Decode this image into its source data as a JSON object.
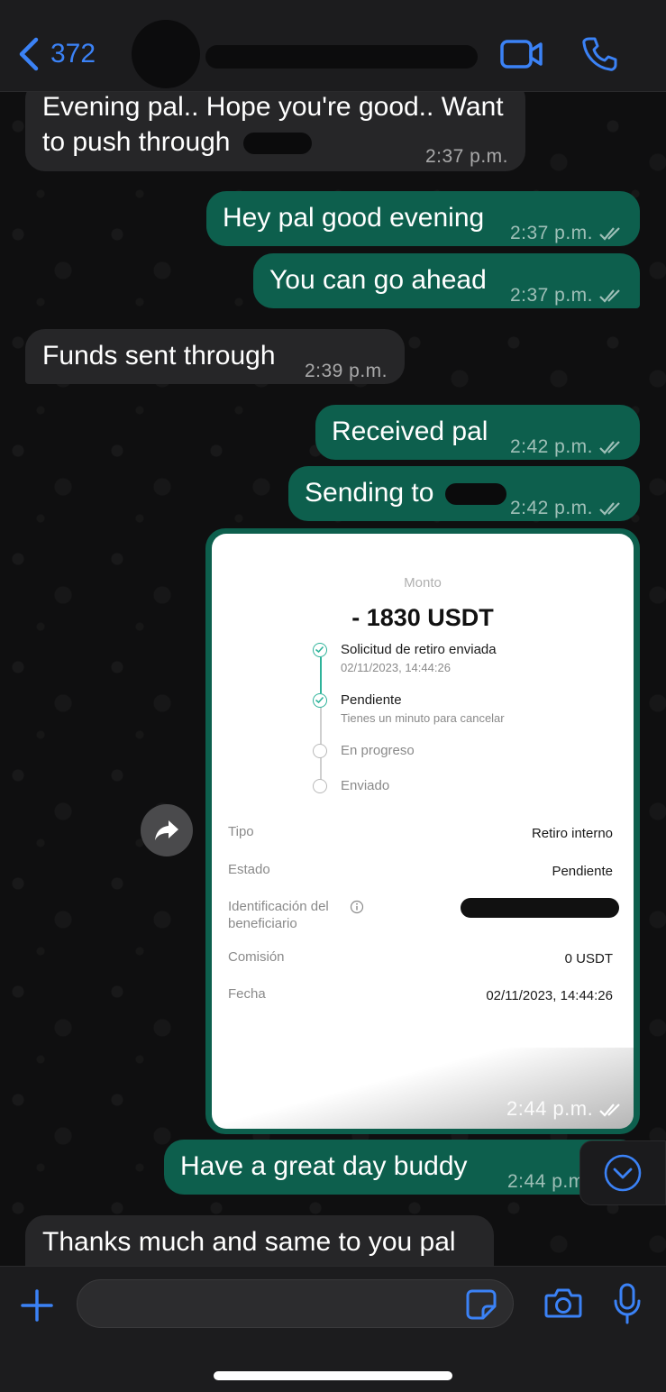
{
  "header": {
    "back_count": "372",
    "contact_name": "",
    "video_icon": "video-camera-icon",
    "call_icon": "phone-icon"
  },
  "messages": [
    {
      "direction": "incoming",
      "text_line1": "Evening pal.. Hope you're good.. Want",
      "text_line2": "to push through",
      "time": "2:37 p.m."
    },
    {
      "direction": "outgoing",
      "text": "Hey pal good evening",
      "time": "2:37 p.m.",
      "status": "read"
    },
    {
      "direction": "outgoing",
      "text": "You can go ahead",
      "time": "2:37 p.m.",
      "status": "read"
    },
    {
      "direction": "incoming",
      "text": "Funds sent through",
      "time": "2:39 p.m."
    },
    {
      "direction": "outgoing",
      "text": "Received pal",
      "time": "2:42 p.m.",
      "status": "read"
    },
    {
      "direction": "outgoing",
      "text": "Sending to",
      "time": "2:42 p.m.",
      "status": "read"
    },
    {
      "direction": "outgoing",
      "type": "image",
      "time": "2:44 p.m.",
      "status": "read"
    },
    {
      "direction": "outgoing",
      "text": "Have a great day buddy",
      "time": "2:44 p.m.",
      "status": "read"
    },
    {
      "direction": "incoming",
      "text": "Thanks much and same to you pal"
    }
  ],
  "receipt": {
    "amount_label": "Monto",
    "amount": "- 1830 USDT",
    "steps": [
      {
        "title": "Solicitud de retiro enviada",
        "subtitle": "02/11/2023, 14:44:26",
        "done": true
      },
      {
        "title": "Pendiente",
        "subtitle": "Tienes un minuto para cancelar",
        "done": true
      },
      {
        "title": "En progreso",
        "done": false
      },
      {
        "title": "Enviado",
        "done": false
      }
    ],
    "details": {
      "tipo_label": "Tipo",
      "tipo_value": "Retiro interno",
      "estado_label": "Estado",
      "estado_value": "Pendiente",
      "id_label_line1": "Identificación del",
      "id_label_line2": "beneficiario",
      "comision_label": "Comisión",
      "comision_value": "0 USDT",
      "fecha_label": "Fecha",
      "fecha_value": "02/11/2023, 14:44:26"
    }
  },
  "input": {
    "placeholder": "",
    "icons": [
      "plus-icon",
      "sticker-icon",
      "camera-icon",
      "microphone-icon"
    ]
  },
  "colors": {
    "accent": "#3b82f6",
    "outgoing_bubble": "#0d5f4d",
    "incoming_bubble": "#262628",
    "receipt_check": "#2fb39a"
  }
}
